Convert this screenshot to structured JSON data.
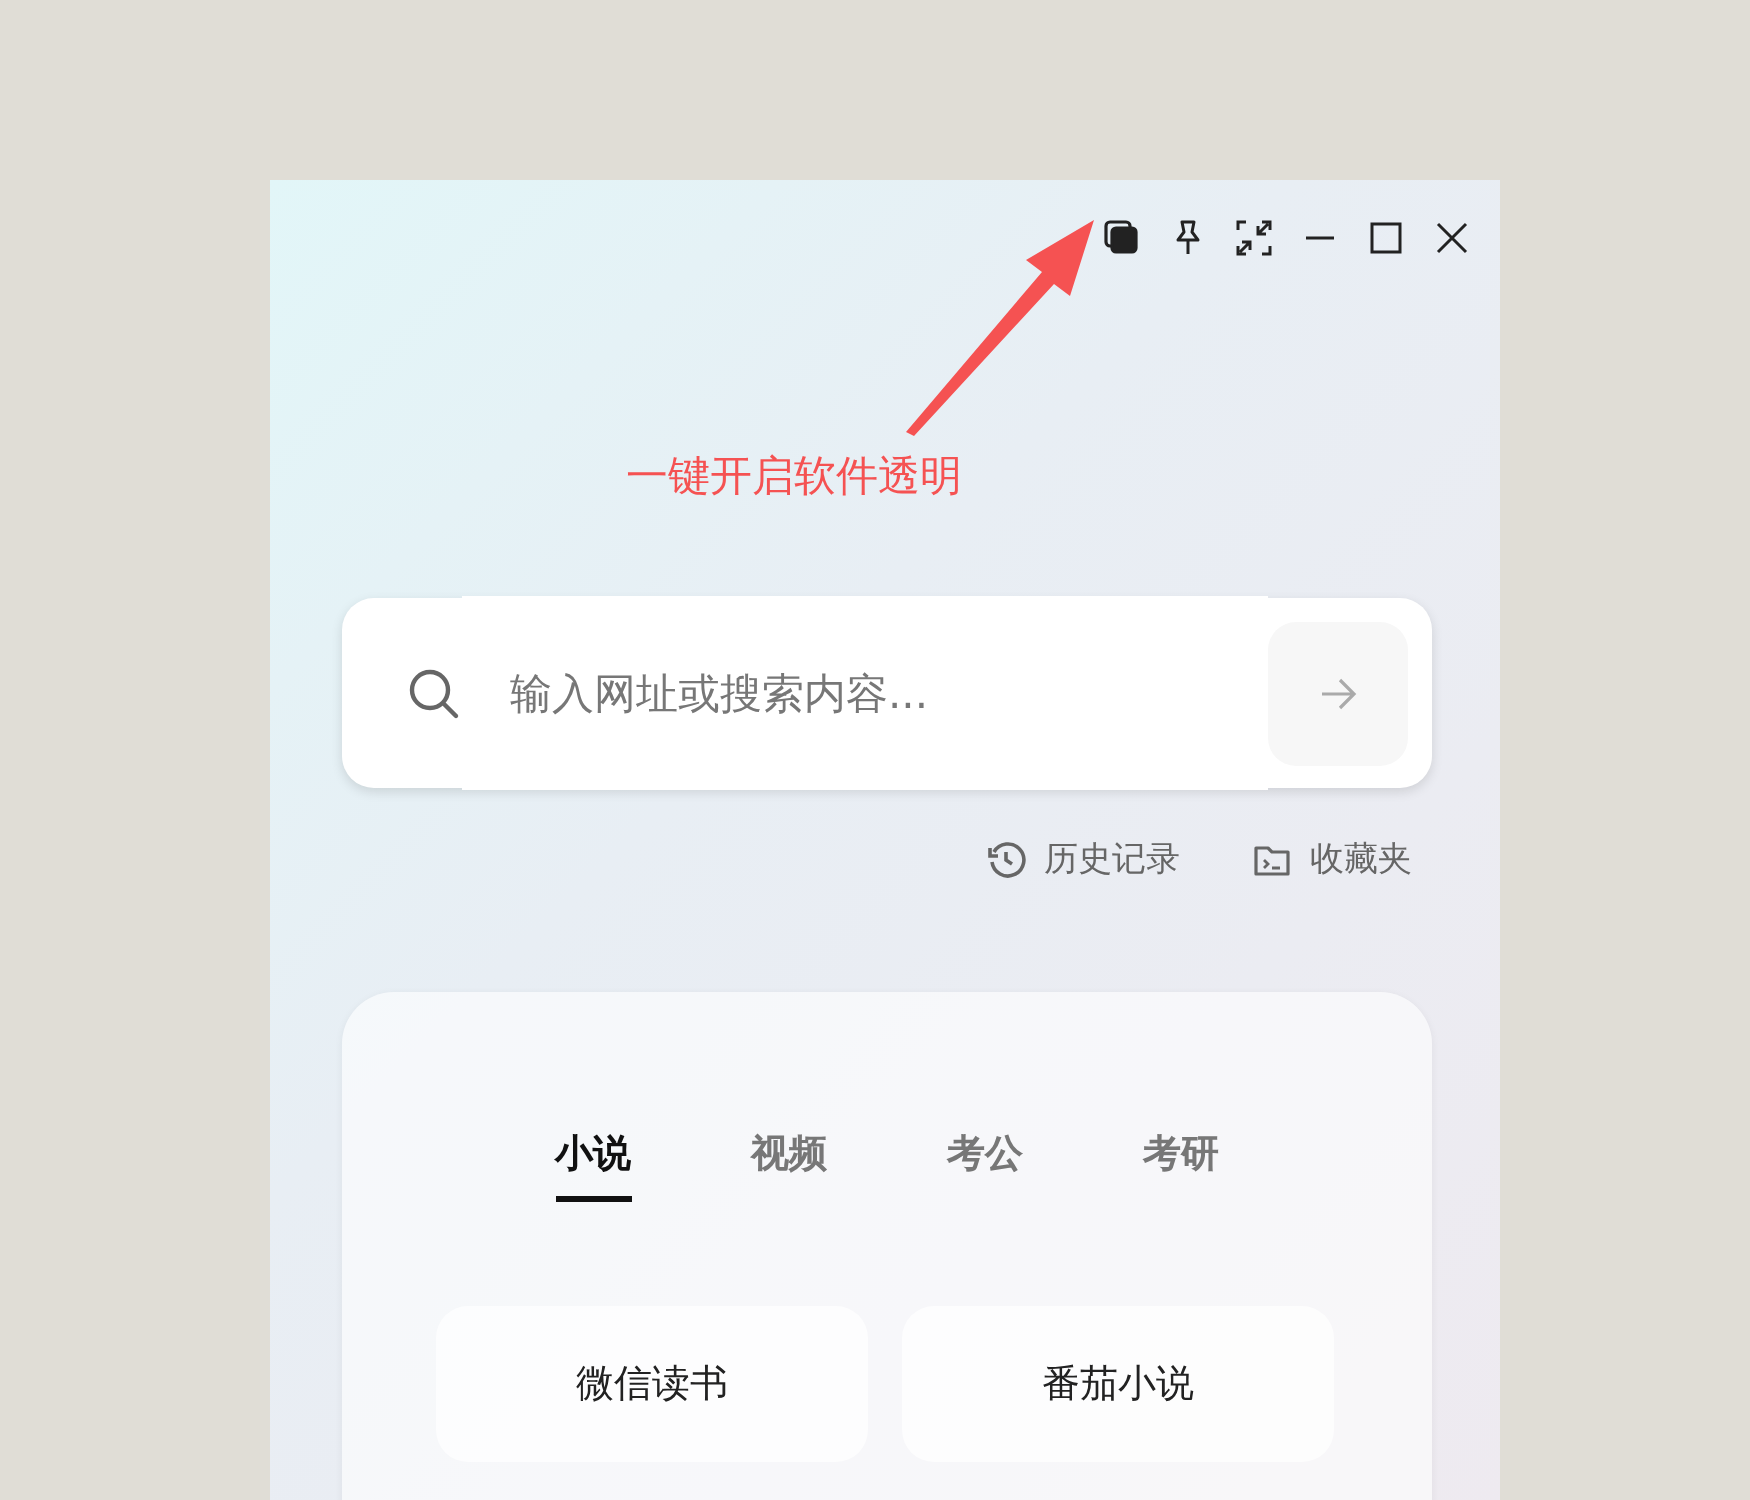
{
  "annotation": {
    "text": "一键开启软件透明"
  },
  "search": {
    "placeholder": "输入网址或搜索内容..."
  },
  "links": [
    {
      "kind": "history",
      "label": "历史记录"
    },
    {
      "kind": "favorites",
      "label": "收藏夹"
    }
  ],
  "tabs": [
    {
      "label": "小说",
      "selected": true
    },
    {
      "label": "视频",
      "selected": false
    },
    {
      "label": "考公",
      "selected": false
    },
    {
      "label": "考研",
      "selected": false
    }
  ],
  "sites": [
    {
      "label": "微信读书"
    },
    {
      "label": "番茄小说"
    }
  ]
}
